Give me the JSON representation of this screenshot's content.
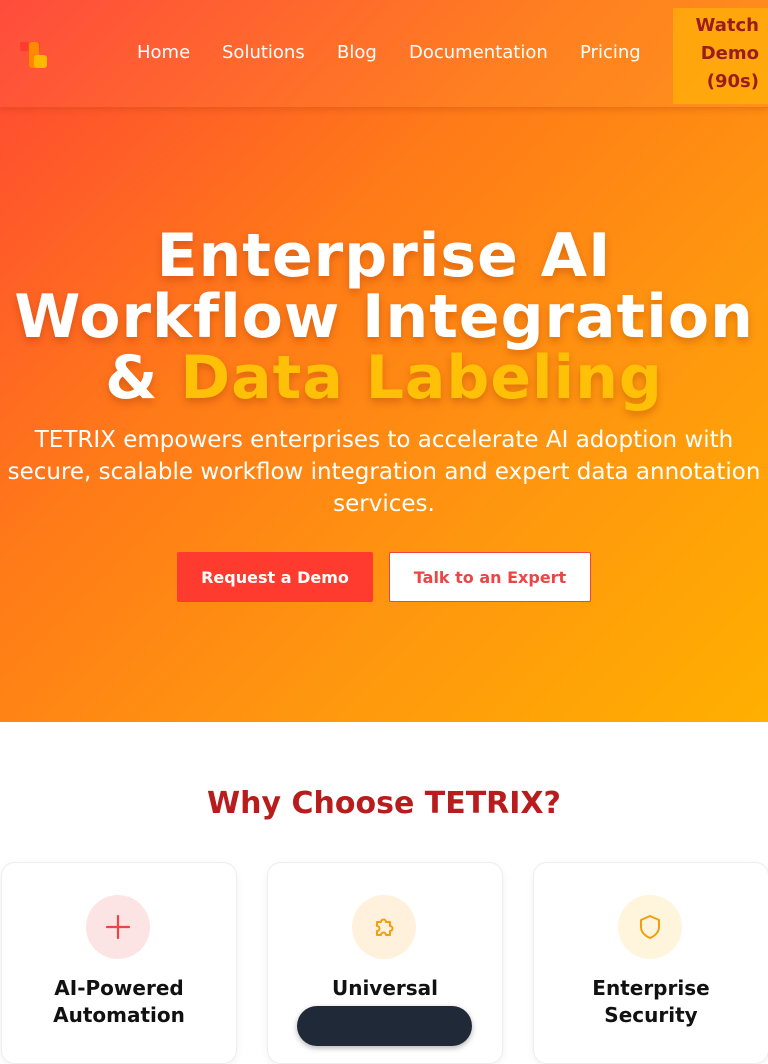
{
  "colors": {
    "brand_red": "#ff3b30",
    "brand_orange": "#ff8c10",
    "accent_yellow": "#ffc107",
    "heading_red": "#b91c1c",
    "demo_text": "#9b1c1c"
  },
  "navbar": {
    "logo_icon": "tetrix-logo-icon",
    "links": [
      "Home",
      "Solutions",
      "Blog",
      "Documentation",
      "Pricing"
    ],
    "watch_demo": "Watch\nDemo\n(90s)"
  },
  "hero": {
    "title_line1": "Enterprise AI",
    "title_line2": "Workflow Integration",
    "title_amp": "& ",
    "title_highlight": "Data Labeling",
    "subtitle": "TETRIX empowers enterprises to accelerate AI adoption with secure, scalable workflow integration and expert data annotation services.",
    "primary_button": "Request a Demo",
    "secondary_button": "Talk to an Expert"
  },
  "features": {
    "title": "Why Choose TETRIX?",
    "cards": [
      {
        "title": "AI-Powered\nAutomation",
        "icon": "plus-icon"
      },
      {
        "title": "Universal",
        "icon": "puzzle-icon"
      },
      {
        "title": "Enterprise\nSecurity",
        "icon": "shield-icon"
      }
    ]
  }
}
